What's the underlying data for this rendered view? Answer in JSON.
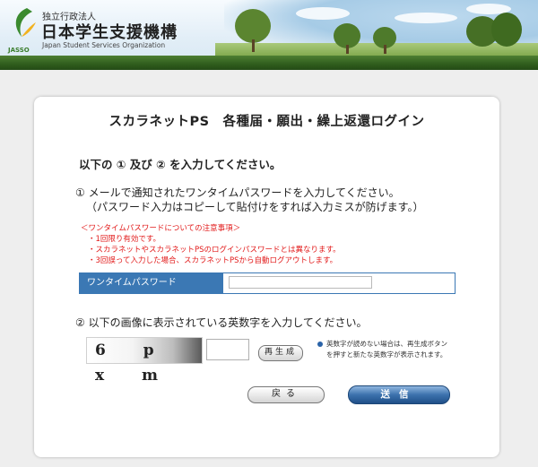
{
  "header": {
    "org_small": "独立行政法人",
    "org_name": "日本学生支援機構",
    "org_en": "Japan Student Services Organization",
    "logo_text": "JASSO"
  },
  "main": {
    "title": "スカラネットPS　各種届・願出・繰上返還ログイン",
    "instruction": "以下の ① 及び ② を入力してください。",
    "step1_line1": "① メールで通知されたワンタイムパスワードを入力してください。",
    "step1_line2": "（パスワード入力はコピーして貼付けをすれば入力ミスが防げます。）",
    "notes_title": "＜ワンタイムパスワードについての注意事項＞",
    "notes": [
      "・1回限り有効です。",
      "・スカラネットやスカラネットPSのログインパスワードとは異なります。",
      "・3回誤って入力した場合、スカラネットPSから自動ログアウトします。"
    ],
    "password_label": "ワンタイムパスワード",
    "password_value": "",
    "step2": "② 以下の画像に表示されている英数字を入力してください。",
    "captcha_text": "6 p x m",
    "captcha_value": "",
    "regen_label": "再生成",
    "regen_note_line1": "英数字が読めない場合は、再生成ボタン",
    "regen_note_line2": "を押すと新たな英数字が表示されます。",
    "back_label": "戻る",
    "submit_label": "送信"
  },
  "colors": {
    "brand_green": "#2f5d1d",
    "accent_blue": "#3b78b4",
    "warning_red": "#e21b1b"
  }
}
